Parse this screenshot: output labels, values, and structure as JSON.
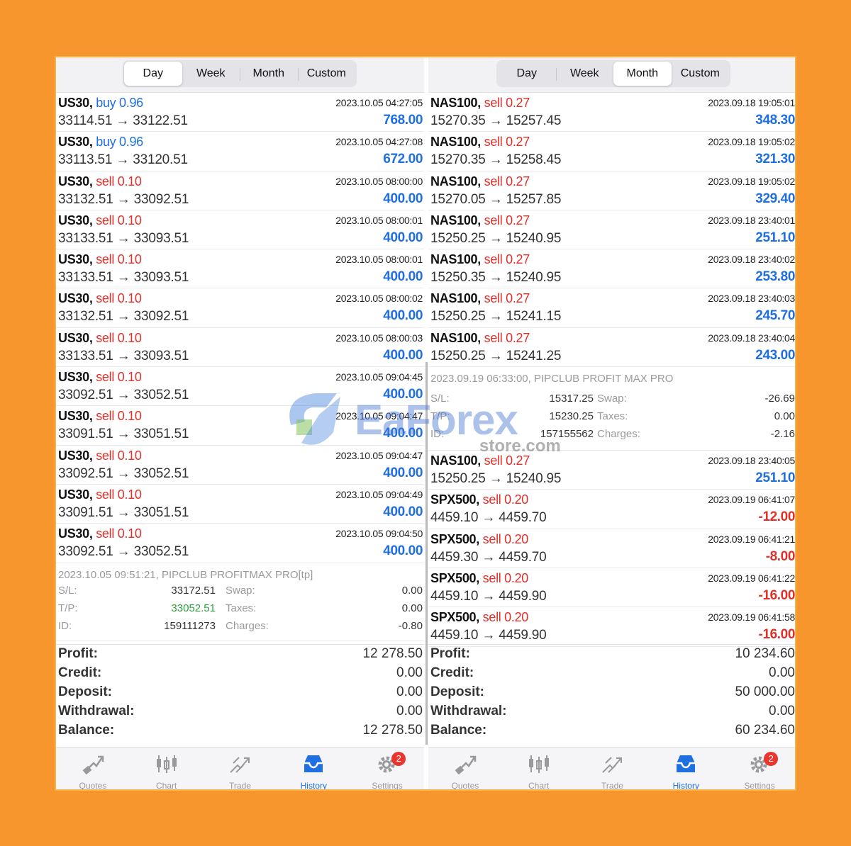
{
  "tabs": [
    "Day",
    "Week",
    "Month",
    "Custom"
  ],
  "left": {
    "active_tab": 0,
    "deals": [
      {
        "symbol": "US30,",
        "side": "buy",
        "volume": "0.96",
        "time": "2023.10.05 04:27:05",
        "open": "33114.51",
        "close": "33122.51",
        "profit": "768.00",
        "kind": "pos"
      },
      {
        "symbol": "US30,",
        "side": "buy",
        "volume": "0.96",
        "time": "2023.10.05 04:27:08",
        "open": "33113.51",
        "close": "33120.51",
        "profit": "672.00",
        "kind": "pos"
      },
      {
        "symbol": "US30,",
        "side": "sell",
        "volume": "0.10",
        "time": "2023.10.05 08:00:00",
        "open": "33132.51",
        "close": "33092.51",
        "profit": "400.00",
        "kind": "pos"
      },
      {
        "symbol": "US30,",
        "side": "sell",
        "volume": "0.10",
        "time": "2023.10.05 08:00:01",
        "open": "33133.51",
        "close": "33093.51",
        "profit": "400.00",
        "kind": "pos"
      },
      {
        "symbol": "US30,",
        "side": "sell",
        "volume": "0.10",
        "time": "2023.10.05 08:00:01",
        "open": "33133.51",
        "close": "33093.51",
        "profit": "400.00",
        "kind": "pos"
      },
      {
        "symbol": "US30,",
        "side": "sell",
        "volume": "0.10",
        "time": "2023.10.05 08:00:02",
        "open": "33132.51",
        "close": "33092.51",
        "profit": "400.00",
        "kind": "pos"
      },
      {
        "symbol": "US30,",
        "side": "sell",
        "volume": "0.10",
        "time": "2023.10.05 08:00:03",
        "open": "33133.51",
        "close": "33093.51",
        "profit": "400.00",
        "kind": "pos"
      },
      {
        "symbol": "US30,",
        "side": "sell",
        "volume": "0.10",
        "time": "2023.10.05 09:04:45",
        "open": "33092.51",
        "close": "33052.51",
        "profit": "400.00",
        "kind": "pos"
      },
      {
        "symbol": "US30,",
        "side": "sell",
        "volume": "0.10",
        "time": "2023.10.05 09:04:47",
        "open": "33091.51",
        "close": "33051.51",
        "profit": "400.00",
        "kind": "pos"
      },
      {
        "symbol": "US30,",
        "side": "sell",
        "volume": "0.10",
        "time": "2023.10.05 09:04:47",
        "open": "33092.51",
        "close": "33052.51",
        "profit": "400.00",
        "kind": "pos"
      },
      {
        "symbol": "US30,",
        "side": "sell",
        "volume": "0.10",
        "time": "2023.10.05 09:04:49",
        "open": "33091.51",
        "close": "33051.51",
        "profit": "400.00",
        "kind": "pos"
      },
      {
        "symbol": "US30,",
        "side": "sell",
        "volume": "0.10",
        "time": "2023.10.05 09:04:50",
        "open": "33092.51",
        "close": "33052.51",
        "profit": "400.00",
        "kind": "pos"
      }
    ],
    "detail": {
      "head": "2023.10.05 09:51:21, PIPCLUB PROFITMAX PRO[tp]",
      "sl_label": "S/L:",
      "sl": "33172.51",
      "tp_label": "T/P:",
      "tp": "33052.51",
      "id_label": "ID:",
      "id": "159111273",
      "swap_label": "Swap:",
      "swap": "0.00",
      "taxes_label": "Taxes:",
      "taxes": "0.00",
      "charges_label": "Charges:",
      "charges": "-0.80"
    },
    "totals": [
      {
        "label": "Profit:",
        "value": "12 278.50"
      },
      {
        "label": "Credit:",
        "value": "0.00"
      },
      {
        "label": "Deposit:",
        "value": "0.00"
      },
      {
        "label": "Withdrawal:",
        "value": "0.00"
      },
      {
        "label": "Balance:",
        "value": "12 278.50"
      }
    ]
  },
  "right": {
    "active_tab": 2,
    "deals_a": [
      {
        "symbol": "NAS100,",
        "side": "sell",
        "volume": "0.27",
        "time": "2023.09.18 19:05:01",
        "open": "15270.35",
        "close": "15257.45",
        "profit": "348.30",
        "kind": "pos"
      },
      {
        "symbol": "NAS100,",
        "side": "sell",
        "volume": "0.27",
        "time": "2023.09.18 19:05:02",
        "open": "15270.35",
        "close": "15258.45",
        "profit": "321.30",
        "kind": "pos"
      },
      {
        "symbol": "NAS100,",
        "side": "sell",
        "volume": "0.27",
        "time": "2023.09.18 19:05:02",
        "open": "15270.05",
        "close": "15257.85",
        "profit": "329.40",
        "kind": "pos"
      },
      {
        "symbol": "NAS100,",
        "side": "sell",
        "volume": "0.27",
        "time": "2023.09.18 23:40:01",
        "open": "15250.25",
        "close": "15240.95",
        "profit": "251.10",
        "kind": "pos"
      },
      {
        "symbol": "NAS100,",
        "side": "sell",
        "volume": "0.27",
        "time": "2023.09.18 23:40:02",
        "open": "15250.35",
        "close": "15240.95",
        "profit": "253.80",
        "kind": "pos"
      },
      {
        "symbol": "NAS100,",
        "side": "sell",
        "volume": "0.27",
        "time": "2023.09.18 23:40:03",
        "open": "15250.25",
        "close": "15241.15",
        "profit": "245.70",
        "kind": "pos"
      },
      {
        "symbol": "NAS100,",
        "side": "sell",
        "volume": "0.27",
        "time": "2023.09.18 23:40:04",
        "open": "15250.25",
        "close": "15241.25",
        "profit": "243.00",
        "kind": "pos"
      }
    ],
    "detail": {
      "head": "2023.09.19 06:33:00, PIPCLUB PROFIT MAX PRO",
      "sl_label": "S/L:",
      "sl": "15317.25",
      "tp_label": "T/P:",
      "tp": "15230.25",
      "id_label": "ID:",
      "id": "157155562",
      "swap_label": "Swap:",
      "swap": "-26.69",
      "taxes_label": "Taxes:",
      "taxes": "0.00",
      "charges_label": "Charges:",
      "charges": "-2.16"
    },
    "deals_b": [
      {
        "symbol": "NAS100,",
        "side": "sell",
        "volume": "0.27",
        "time": "2023.09.18 23:40:05",
        "open": "15250.25",
        "close": "15240.95",
        "profit": "251.10",
        "kind": "pos"
      },
      {
        "symbol": "SPX500,",
        "side": "sell",
        "volume": "0.20",
        "time": "2023.09.19 06:41:07",
        "open": "4459.10",
        "close": "4459.70",
        "profit": "-12.00",
        "kind": "neg"
      },
      {
        "symbol": "SPX500,",
        "side": "sell",
        "volume": "0.20",
        "time": "2023.09.19 06:41:21",
        "open": "4459.30",
        "close": "4459.70",
        "profit": "-8.00",
        "kind": "neg"
      },
      {
        "symbol": "SPX500,",
        "side": "sell",
        "volume": "0.20",
        "time": "2023.09.19 06:41:22",
        "open": "4459.10",
        "close": "4459.90",
        "profit": "-16.00",
        "kind": "neg"
      },
      {
        "symbol": "SPX500,",
        "side": "sell",
        "volume": "0.20",
        "time": "2023.09.19 06:41:58",
        "open": "4459.10",
        "close": "4459.90",
        "profit": "-16.00",
        "kind": "neg"
      }
    ],
    "totals": [
      {
        "label": "Profit:",
        "value": "10 234.60"
      },
      {
        "label": "Credit:",
        "value": "0.00"
      },
      {
        "label": "Deposit:",
        "value": "50 000.00"
      },
      {
        "label": "Withdrawal:",
        "value": "0.00"
      },
      {
        "label": "Balance:",
        "value": "60 234.60"
      }
    ]
  },
  "tabbar": {
    "items": [
      {
        "label": "Quotes",
        "icon": "quotes-icon"
      },
      {
        "label": "Chart",
        "icon": "chart-icon"
      },
      {
        "label": "Trade",
        "icon": "trade-icon"
      },
      {
        "label": "History",
        "icon": "history-icon"
      },
      {
        "label": "Settings",
        "icon": "settings-icon"
      }
    ],
    "active": 3,
    "badge": "2"
  },
  "watermark": {
    "text": "EaForex",
    "sub": "store.com"
  },
  "colors": {
    "buy": "#1f6fe0",
    "sell": "#e0302a",
    "profit_pos": "#1f6fe0",
    "profit_neg": "#e0302a",
    "accent": "#1f6fe0",
    "background": "#f7962d"
  }
}
